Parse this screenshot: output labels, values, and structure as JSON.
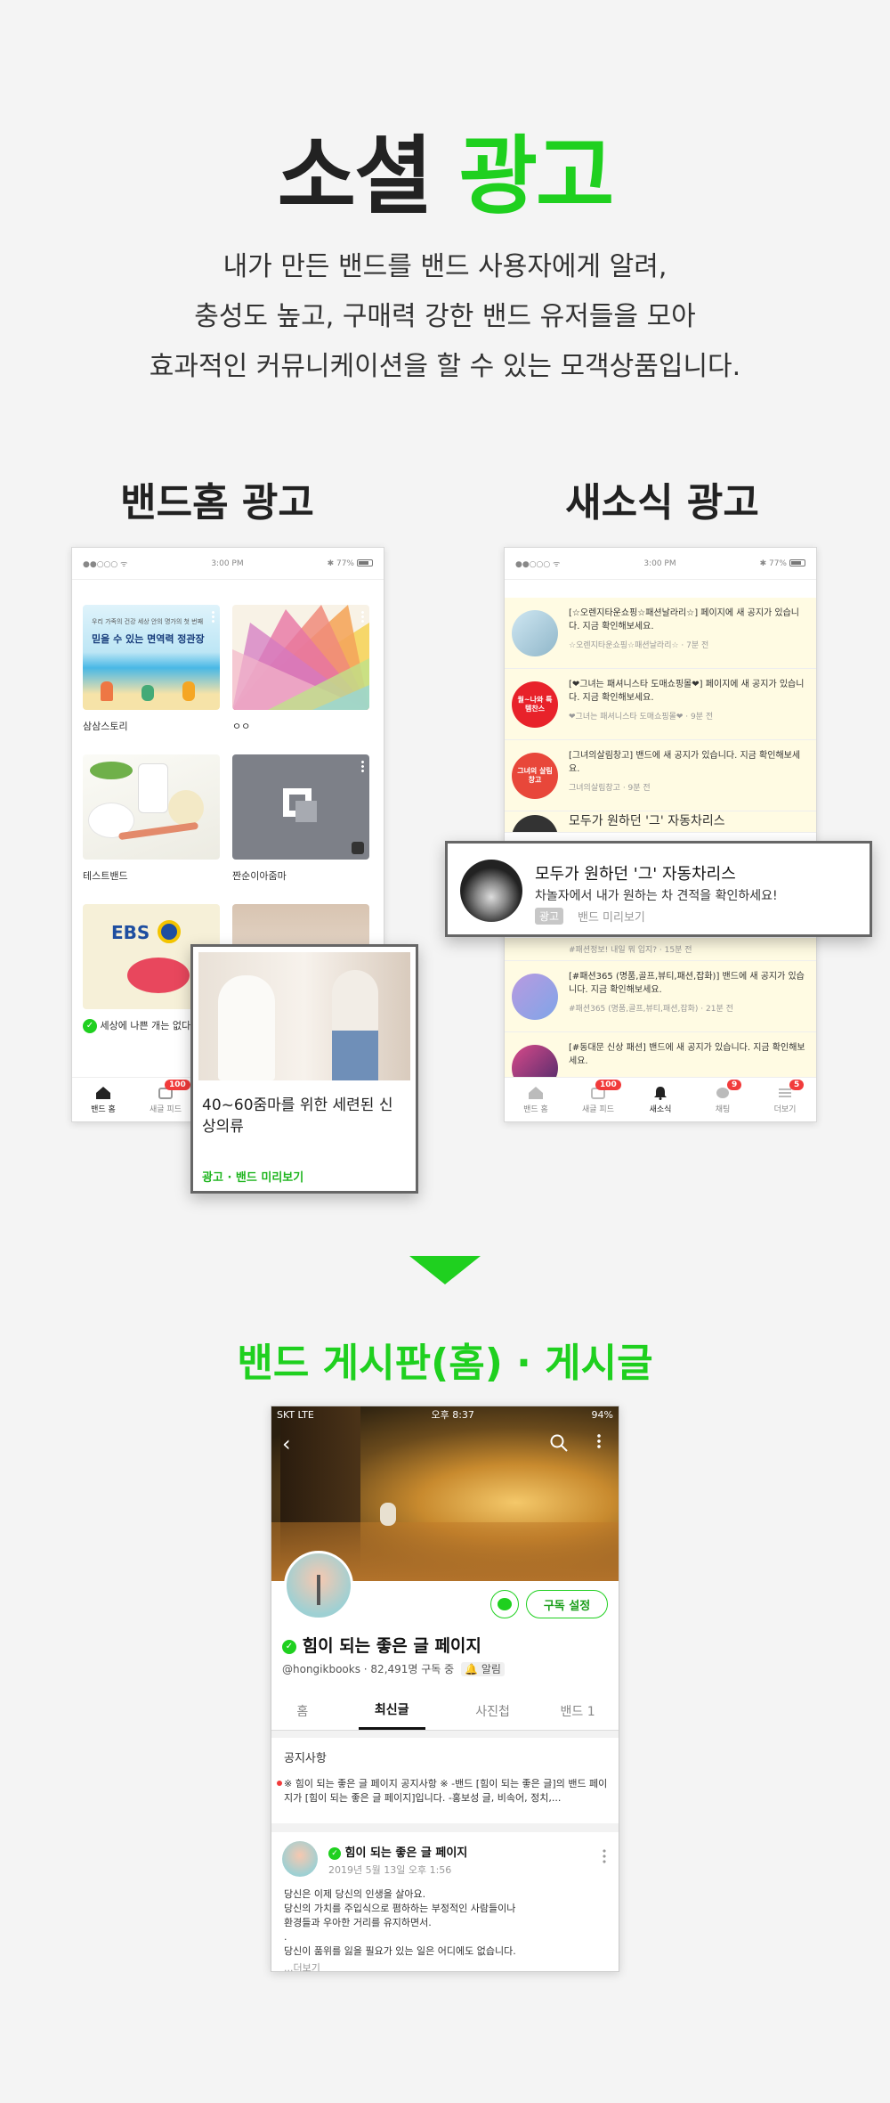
{
  "hero": {
    "title_black": "소셜",
    "title_green": "광고",
    "desc": [
      "내가 만든 밴드를 밴드 사용자에게 알려,",
      "충성도 높고, 구매력 강한 밴드 유저들을 모아",
      "효과적인 커뮤니케이션을 할 수 있는 모객상품입니다."
    ]
  },
  "band_home": {
    "title": "밴드홈 광고",
    "status": {
      "left": "●●○○○ ᯤ",
      "time": "3:00 PM",
      "battery": "✱ 77%"
    },
    "cards": [
      {
        "label": "삼삼스토리",
        "banner_small": "우리 가족의 건강 세상 안의 명가의 첫 번째",
        "banner_big": "믿을 수 있는 면역력 정관장"
      },
      {
        "label": "ㅇㅇ"
      },
      {
        "label": "테스트밴드"
      },
      {
        "label": "짠순이아줌마"
      },
      {
        "label": "세상에 나쁜 개는 없다",
        "banner": "EBS"
      }
    ],
    "tabs": [
      {
        "label": "밴드 홈"
      },
      {
        "label": "새글 피드",
        "badge": "100"
      }
    ],
    "popup": {
      "title": "40~60줌마를 위한 세련된 신상의류",
      "meta": "광고 · 밴드 미리보기"
    }
  },
  "news": {
    "title": "새소식 광고",
    "status": {
      "left": "●●○○○ ᯤ",
      "time": "3:00 PM",
      "battery": "✱ 77%"
    },
    "items": [
      {
        "text": "[☆오렌지타운쇼핑☆패션날라리☆] 페이지에 새 공지가 있습니다. 지금 확인해보세요.",
        "sub": "☆오렌지타운쇼핑☆패션날라리☆ · 7분 전"
      },
      {
        "text": "[❤그녀는 패셔니스타 도매쇼핑몰❤] 페이지에 새 공지가 있습니다. 지금 확인해보세요.",
        "sub": "❤그녀는 패셔니스타 도매쇼핑몰❤ · 9분 전",
        "icon": "월~나와 특템찬스"
      },
      {
        "text": "[그녀의살림창고] 밴드에 새 공지가 있습니다. 지금 확인해보세요.",
        "sub": "그녀의살림창고 · 9분 전",
        "icon": "그녀의 살림창고"
      },
      {
        "text": "모두가 원하던 '그' 자동차리스",
        "sub": ""
      },
      {
        "text": "",
        "sub": "#패션정보! 내일 뭐 입지? · 15분 전"
      },
      {
        "text": "[#패션365 (명품,골프,뷰티,패션,잡화)] 밴드에 새 공지가 있습니다. 지금 확인해보세요.",
        "sub": "#패션365 (명품,골프,뷰티,패션,잡화) · 21분 전"
      },
      {
        "text": "[#동대문 신상 패션] 밴드에 새 공지가 있습니다. 지금 확인해보세요.",
        "sub": ""
      }
    ],
    "tabs": [
      {
        "label": "밴드 홈"
      },
      {
        "label": "새글 피드",
        "badge": "100"
      },
      {
        "label": "새소식"
      },
      {
        "label": "채팅",
        "badge": "9"
      },
      {
        "label": "더보기",
        "badge": "5"
      }
    ],
    "popup": {
      "title": "모두가 원하던 '그' 자동차리스",
      "desc": "차놀자에서 내가 원하는 차 견적을 확인하세요!",
      "ad_tag": "광고",
      "meta": "밴드 미리보기"
    }
  },
  "section2": {
    "title": "밴드 게시판(홈) · 게시글",
    "phone": {
      "carrier": "SKT  LTE",
      "time": "오후 8:37",
      "battery": "94%",
      "subscribe": "구독 설정",
      "page_name": "힘이 되는 좋은 글 페이지",
      "handle": "@hongikbooks",
      "subscribers": "· 82,491명 구독 중",
      "alarm": "알림",
      "tabs": [
        "홈",
        "최신글",
        "사진첩",
        "밴드 1"
      ],
      "notice_title": "공지사항",
      "notice_text": "※ 힘이 되는 좋은 글 페이지 공지사항 ※ -밴드 [힘이 되는 좋은 글]의 밴드 페이지가 [힘이 되는 좋은 글 페이지]입니다. -홍보성 글, 비속어, 정치,...",
      "post_author": "힘이 되는 좋은 글 페이지",
      "post_date": "2019년 5월 13일 오후 1:56",
      "post_lines": [
        "당신은 이제 당신의 인생을 살아요.",
        "당신의 가치를 주입식으로 폄하하는 부정적인 사람들이나",
        "환경들과 우아한 거리를 유지하면서.",
        ".",
        "당신이 품위를 잃을 필요가 있는 일은 어디에도 없습니다."
      ],
      "more": "...더보기"
    }
  },
  "colors": {
    "green": "#1fd01f",
    "badge_red": "#f13b3b",
    "news_bg": "#fffbe3"
  }
}
